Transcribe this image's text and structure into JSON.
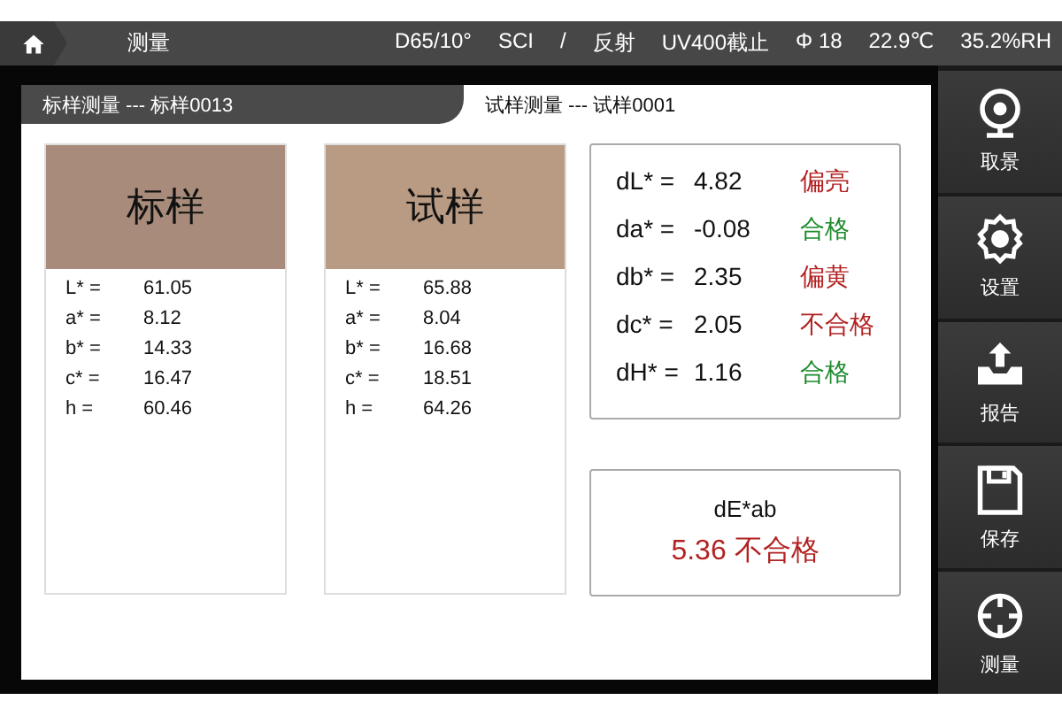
{
  "top_bar": {
    "title": "测量",
    "status": [
      "D65/10°",
      "SCI",
      "/",
      "反射",
      "UV400截止",
      "Φ 18",
      "22.9℃",
      "35.2%RH"
    ]
  },
  "tabs": [
    {
      "label": "标样测量 --- 标样0013",
      "selected": false
    },
    {
      "label": "试样测量 --- 试样0001",
      "selected": true
    }
  ],
  "samples": [
    {
      "name": "标样",
      "color": "#a88b7a",
      "values": [
        {
          "label": "L* =",
          "value": "61.05"
        },
        {
          "label": "a* =",
          "value": "8.12"
        },
        {
          "label": "b* =",
          "value": "14.33"
        },
        {
          "label": "c* =",
          "value": "16.47"
        },
        {
          "label": "h =",
          "value": "60.46"
        }
      ]
    },
    {
      "name": "试样",
      "color": "#b99a83",
      "values": [
        {
          "label": "L* =",
          "value": "65.88"
        },
        {
          "label": "a* =",
          "value": "8.04"
        },
        {
          "label": "b*  =",
          "value": "16.68"
        },
        {
          "label": "c* =",
          "value": "18.51"
        },
        {
          "label": "h =",
          "value": "64.26"
        }
      ]
    }
  ],
  "differences": [
    {
      "label": "dL* =",
      "value": "4.82",
      "verdict": "偏亮",
      "color": "#b22222"
    },
    {
      "label": "da* =",
      "value": "-0.08",
      "verdict": "合格",
      "color": "#1e8b2e"
    },
    {
      "label": "db* =",
      "value": "2.35",
      "verdict": "偏黄",
      "color": "#b22222"
    },
    {
      "label": "dc* =",
      "value": "2.05",
      "verdict": "不合格",
      "color": "#b22222"
    },
    {
      "label": "dH* =",
      "value": "1.16",
      "verdict": "合格",
      "color": "#1e8b2e"
    }
  ],
  "total": {
    "label": "dE*ab",
    "value": "5.36 不合格"
  },
  "sidebar": [
    {
      "label": "取景",
      "kind": "camera"
    },
    {
      "label": "设置",
      "kind": "gear"
    },
    {
      "label": "报告",
      "kind": "upload"
    },
    {
      "label": "保存",
      "kind": "save"
    },
    {
      "label": "测量",
      "kind": "target"
    }
  ]
}
